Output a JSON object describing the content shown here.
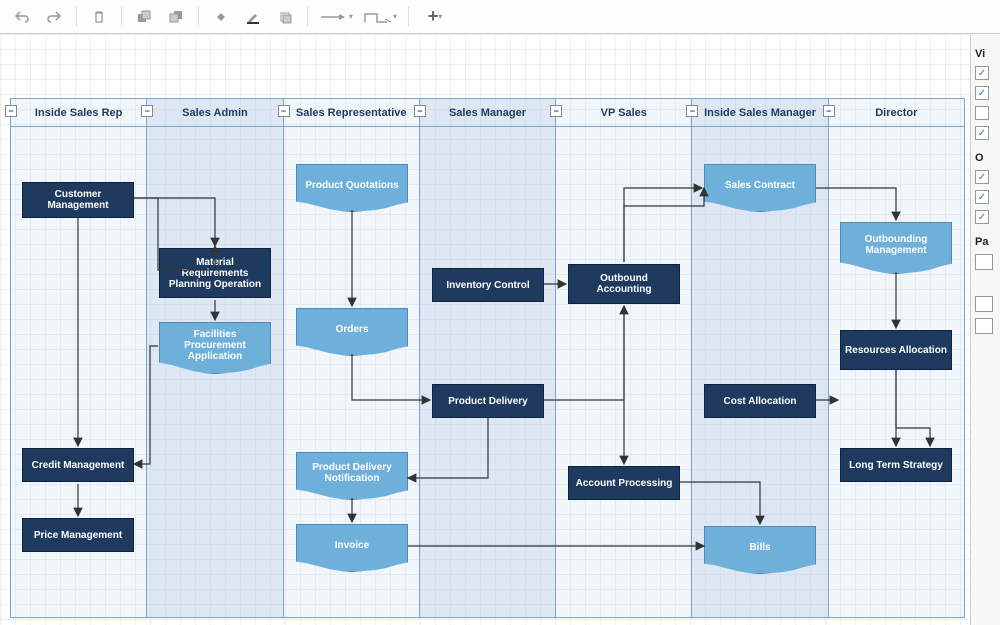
{
  "toolbar": {
    "undo": "Undo",
    "redo": "Redo",
    "delete": "Delete",
    "front": "To Front",
    "back": "To Back",
    "fill": "Fill",
    "line": "Line",
    "shadow": "Shadow",
    "conn": "Connection",
    "waypoint": "Waypoint",
    "add": "Add"
  },
  "lanes": [
    {
      "title": "Inside Sales Rep"
    },
    {
      "title": "Sales Admin"
    },
    {
      "title": "Sales Representative"
    },
    {
      "title": "Sales Manager"
    },
    {
      "title": "VP Sales"
    },
    {
      "title": "Inside Sales Manager"
    },
    {
      "title": "Director"
    }
  ],
  "nodes": {
    "customer_mgmt": "Customer Management",
    "credit_mgmt": "Credit Management",
    "price_mgmt": "Price Management",
    "mrp": "Material Requirements Planning Operation",
    "facilities": "Facilities Procurement Application",
    "product_quot": "Product Quotations",
    "orders": "Orders",
    "pdn": "Product Delivery Notification",
    "invoice": "Invoice",
    "inv_control": "Inventory Control",
    "prod_delivery": "Product Delivery",
    "outbound_acct": "Outbound Accounting",
    "acct_proc": "Account Processing",
    "bills": "Bills",
    "sales_contract": "Sales Contract",
    "cost_alloc": "Cost Allocation",
    "outbound_mgmt": "Outbounding Management",
    "res_alloc": "Resources Allocation",
    "strategy": "Long Term Strategy"
  },
  "sidepanel": {
    "s1": "Vi",
    "s2": "O",
    "s3": "Pa"
  }
}
